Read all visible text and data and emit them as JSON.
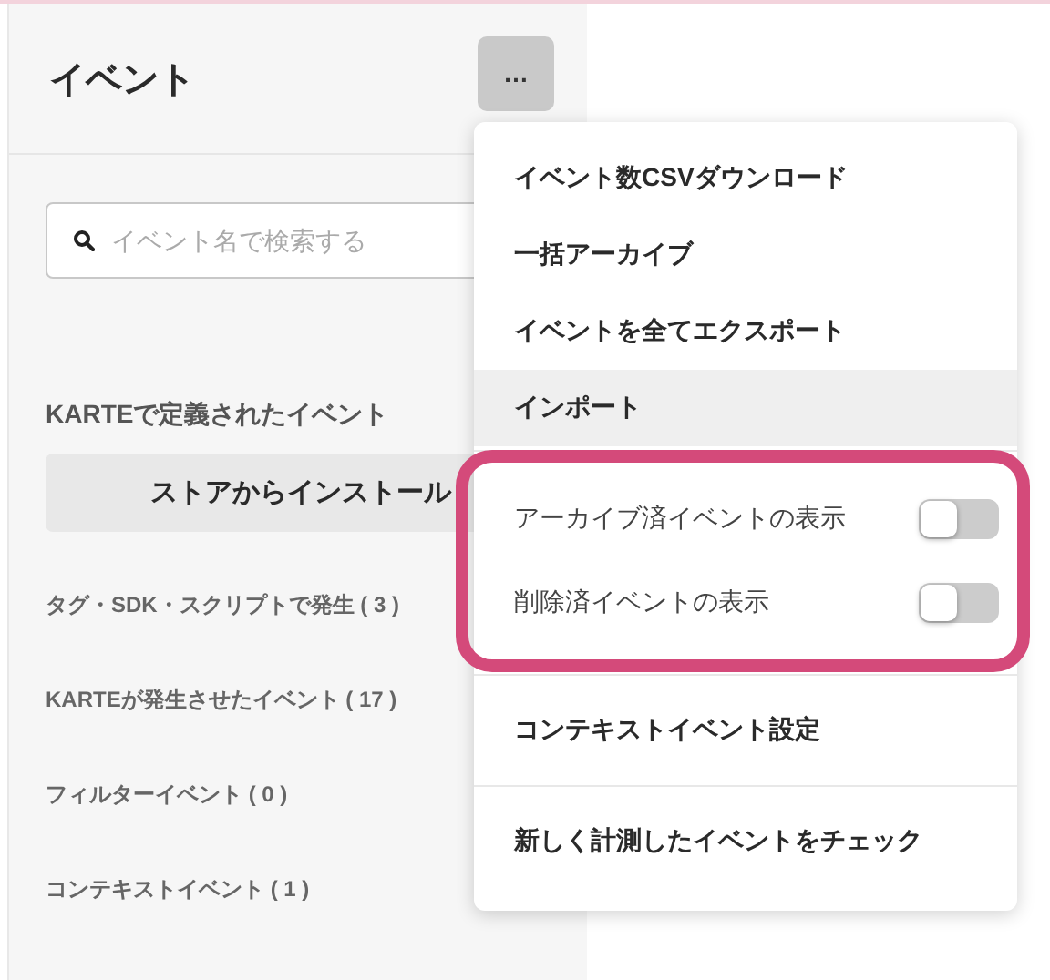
{
  "sidebar": {
    "title": "イベント",
    "more_button": "…",
    "search": {
      "placeholder": "イベント名で検索する"
    },
    "section_label": "KARTEで定義されたイベント",
    "install_button": "ストアからインストール",
    "categories": [
      {
        "label": "タグ・SDK・スクリプトで発生 ( 3 )"
      },
      {
        "label": "KARTEが発生させたイベント ( 17 )"
      },
      {
        "label": "フィルターイベント ( 0 )"
      },
      {
        "label": "コンテキストイベント ( 1 )"
      }
    ]
  },
  "menu": {
    "groups": [
      {
        "items": [
          {
            "kind": "action",
            "label": "イベント数CSVダウンロード",
            "hovered": false
          },
          {
            "kind": "action",
            "label": "一括アーカイブ",
            "hovered": false
          },
          {
            "kind": "action",
            "label": "イベントを全てエクスポート",
            "hovered": false
          },
          {
            "kind": "action",
            "label": "インポート",
            "hovered": true
          }
        ]
      },
      {
        "highlighted": true,
        "items": [
          {
            "kind": "toggle",
            "label": "アーカイブ済イベントの表示",
            "on": false
          },
          {
            "kind": "toggle",
            "label": "削除済イベントの表示",
            "on": false
          }
        ]
      },
      {
        "items": [
          {
            "kind": "action",
            "label": "コンテキストイベント設定",
            "hovered": false
          }
        ]
      },
      {
        "items": [
          {
            "kind": "action",
            "label": "新しく計測したイベントをチェック",
            "hovered": false
          }
        ]
      }
    ]
  }
}
